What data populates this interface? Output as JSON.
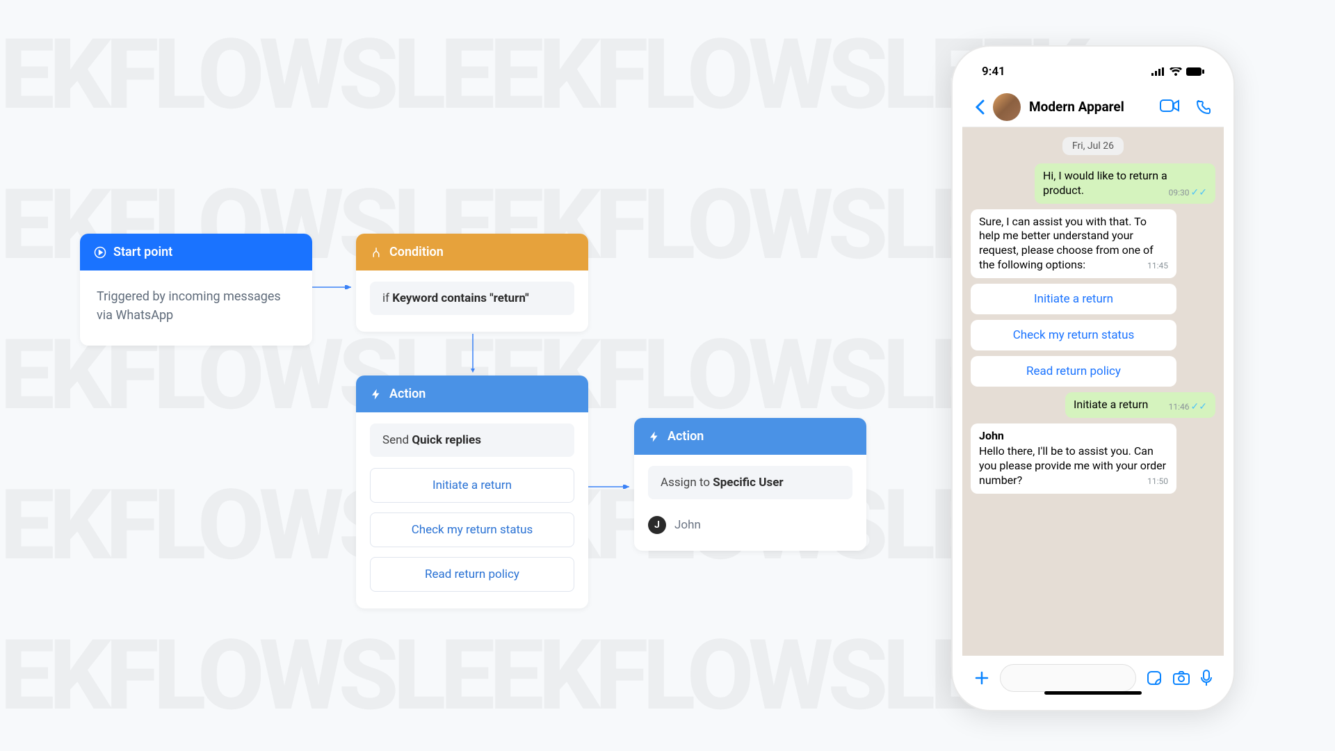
{
  "flow": {
    "start": {
      "header": "Start point",
      "body": "Triggered by incoming messages via WhatsApp"
    },
    "condition": {
      "header": "Condition",
      "if_prefix": "if ",
      "if_bold": "Keyword contains \"return\""
    },
    "action1": {
      "header": "Action",
      "send_prefix": "Send ",
      "send_bold": "Quick replies",
      "replies": [
        "Initiate a return",
        "Check my return status",
        "Read return policy"
      ]
    },
    "action2": {
      "header": "Action",
      "assign_prefix": "Assign to ",
      "assign_bold": "Specific User",
      "user_initial": "J",
      "user_name": "John"
    }
  },
  "phone": {
    "status_time": "9:41",
    "contact_name": "Modern Apparel",
    "chat_date": "Fri, Jul 26",
    "msg1": {
      "text": "Hi, I would like to return a product.",
      "time": "09:30"
    },
    "msg2": {
      "text": "Sure, I can assist you with that. To help me better understand your request, please choose from one of the following options:",
      "time": "11:45"
    },
    "options": [
      "Initiate a return",
      "Check my return status",
      "Read return policy"
    ],
    "msg3": {
      "text": "Initiate a return",
      "time": "11:46"
    },
    "msg4": {
      "name": "John",
      "text": "Hello there, I'll be to assist you. Can you please provide me with your order number?",
      "time": "11:50"
    }
  }
}
